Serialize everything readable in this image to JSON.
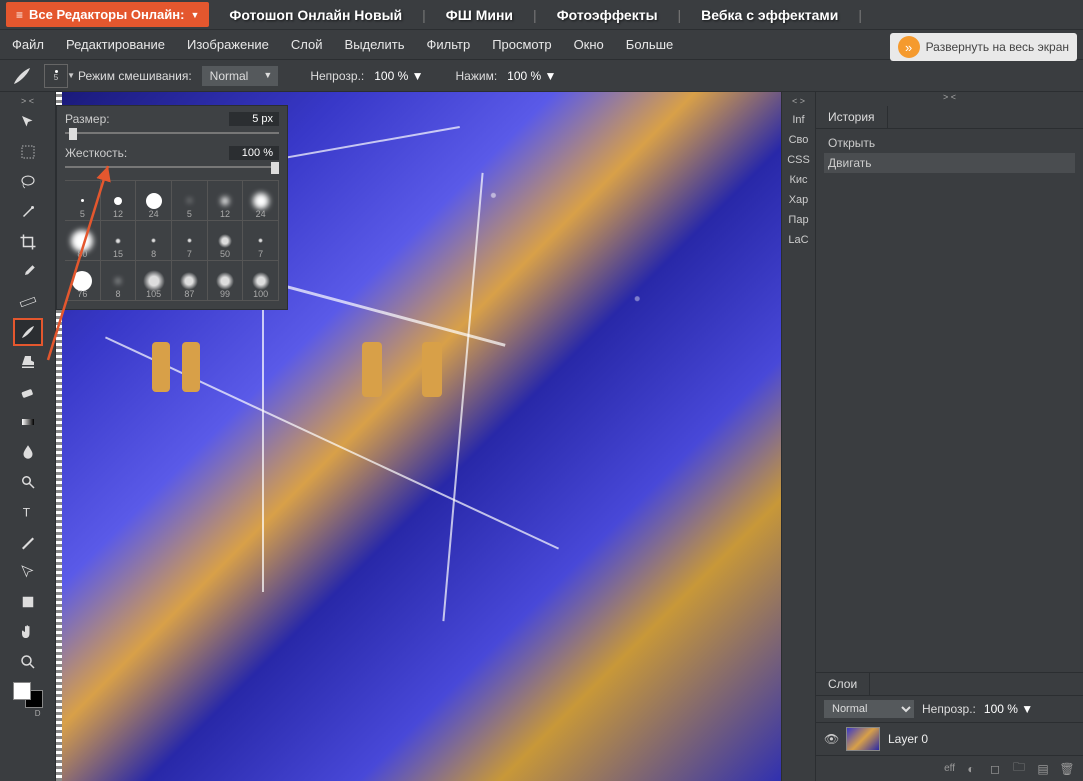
{
  "topnav": {
    "all_editors": "Все Редакторы Онлайн:",
    "links": [
      "Фотошоп Онлайн Новый",
      "ФШ Мини",
      "Фотоэффекты",
      "Вебка с эффектами"
    ]
  },
  "menubar": {
    "items": [
      "Файл",
      "Редактирование",
      "Изображение",
      "Слой",
      "Выделить",
      "Фильтр",
      "Просмотр",
      "Окно",
      "Больше"
    ],
    "expand": "Развернуть на весь экран"
  },
  "optbar": {
    "brush_preview_num": "5",
    "blend_label": "Режим смешивания:",
    "blend_value": "Normal",
    "opacity_label": "Непрозр.:",
    "opacity_value": "100 %",
    "flow_label": "Нажим:",
    "flow_value": "100 %"
  },
  "brush_popup": {
    "size_label": "Размер:",
    "size_value": "5  px",
    "hardness_label": "Жесткость:",
    "hardness_value": "100 %",
    "presets": [
      {
        "n": "5",
        "d": 3,
        "soft": false
      },
      {
        "n": "12",
        "d": 8,
        "soft": false
      },
      {
        "n": "24",
        "d": 16,
        "soft": false
      },
      {
        "n": "5",
        "d": 3,
        "soft": true
      },
      {
        "n": "12",
        "d": 8,
        "soft": true
      },
      {
        "n": "24",
        "d": 16,
        "soft": true
      },
      {
        "n": "80",
        "d": 22,
        "soft": true
      },
      {
        "n": "15",
        "d": 6,
        "tex": true
      },
      {
        "n": "8",
        "d": 5,
        "tex": true
      },
      {
        "n": "7",
        "d": 5,
        "tex": true
      },
      {
        "n": "50",
        "d": 14,
        "tex": true
      },
      {
        "n": "7",
        "d": 5,
        "tex": true
      },
      {
        "n": "76",
        "d": 20,
        "soft": false
      },
      {
        "n": "8",
        "d": 4,
        "soft": true
      },
      {
        "n": "105",
        "d": 22,
        "tex": true
      },
      {
        "n": "87",
        "d": 18,
        "tex": true
      },
      {
        "n": "99",
        "d": 18,
        "tex": true
      },
      {
        "n": "100",
        "d": 18,
        "tex": true
      }
    ]
  },
  "info_strip": [
    "Inf",
    "Сво",
    "CSS",
    "Кис",
    "Хар",
    "Пар",
    "LaC"
  ],
  "history": {
    "tab": "История",
    "items": [
      "Открыть",
      "Двигать"
    ]
  },
  "layers": {
    "tab": "Слои",
    "blend": "Normal",
    "opacity_label": "Непрозр.:",
    "opacity_value": "100 %",
    "layer0": "Layer 0"
  },
  "footer": {
    "eff": "eff"
  },
  "swatch_label": "D"
}
